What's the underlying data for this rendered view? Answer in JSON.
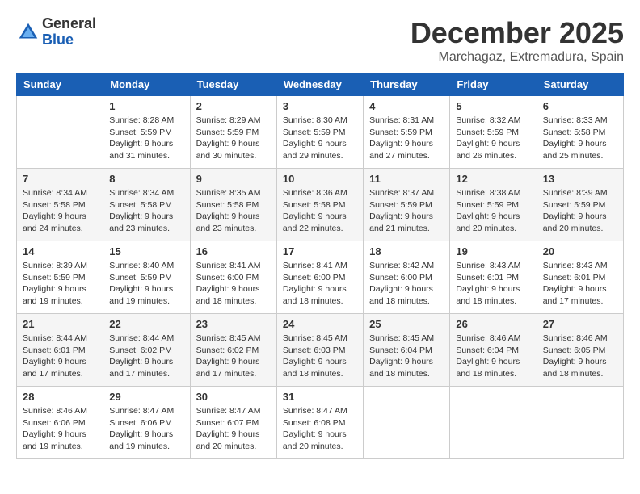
{
  "logo": {
    "general": "General",
    "blue": "Blue"
  },
  "title": "December 2025",
  "location": "Marchagaz, Extremadura, Spain",
  "days_of_week": [
    "Sunday",
    "Monday",
    "Tuesday",
    "Wednesday",
    "Thursday",
    "Friday",
    "Saturday"
  ],
  "weeks": [
    [
      {
        "day": "",
        "sunrise": "",
        "sunset": "",
        "daylight": ""
      },
      {
        "day": "1",
        "sunrise": "Sunrise: 8:28 AM",
        "sunset": "Sunset: 5:59 PM",
        "daylight": "Daylight: 9 hours and 31 minutes."
      },
      {
        "day": "2",
        "sunrise": "Sunrise: 8:29 AM",
        "sunset": "Sunset: 5:59 PM",
        "daylight": "Daylight: 9 hours and 30 minutes."
      },
      {
        "day": "3",
        "sunrise": "Sunrise: 8:30 AM",
        "sunset": "Sunset: 5:59 PM",
        "daylight": "Daylight: 9 hours and 29 minutes."
      },
      {
        "day": "4",
        "sunrise": "Sunrise: 8:31 AM",
        "sunset": "Sunset: 5:59 PM",
        "daylight": "Daylight: 9 hours and 27 minutes."
      },
      {
        "day": "5",
        "sunrise": "Sunrise: 8:32 AM",
        "sunset": "Sunset: 5:59 PM",
        "daylight": "Daylight: 9 hours and 26 minutes."
      },
      {
        "day": "6",
        "sunrise": "Sunrise: 8:33 AM",
        "sunset": "Sunset: 5:58 PM",
        "daylight": "Daylight: 9 hours and 25 minutes."
      }
    ],
    [
      {
        "day": "7",
        "sunrise": "Sunrise: 8:34 AM",
        "sunset": "Sunset: 5:58 PM",
        "daylight": "Daylight: 9 hours and 24 minutes."
      },
      {
        "day": "8",
        "sunrise": "Sunrise: 8:34 AM",
        "sunset": "Sunset: 5:58 PM",
        "daylight": "Daylight: 9 hours and 23 minutes."
      },
      {
        "day": "9",
        "sunrise": "Sunrise: 8:35 AM",
        "sunset": "Sunset: 5:58 PM",
        "daylight": "Daylight: 9 hours and 23 minutes."
      },
      {
        "day": "10",
        "sunrise": "Sunrise: 8:36 AM",
        "sunset": "Sunset: 5:58 PM",
        "daylight": "Daylight: 9 hours and 22 minutes."
      },
      {
        "day": "11",
        "sunrise": "Sunrise: 8:37 AM",
        "sunset": "Sunset: 5:59 PM",
        "daylight": "Daylight: 9 hours and 21 minutes."
      },
      {
        "day": "12",
        "sunrise": "Sunrise: 8:38 AM",
        "sunset": "Sunset: 5:59 PM",
        "daylight": "Daylight: 9 hours and 20 minutes."
      },
      {
        "day": "13",
        "sunrise": "Sunrise: 8:39 AM",
        "sunset": "Sunset: 5:59 PM",
        "daylight": "Daylight: 9 hours and 20 minutes."
      }
    ],
    [
      {
        "day": "14",
        "sunrise": "Sunrise: 8:39 AM",
        "sunset": "Sunset: 5:59 PM",
        "daylight": "Daylight: 9 hours and 19 minutes."
      },
      {
        "day": "15",
        "sunrise": "Sunrise: 8:40 AM",
        "sunset": "Sunset: 5:59 PM",
        "daylight": "Daylight: 9 hours and 19 minutes."
      },
      {
        "day": "16",
        "sunrise": "Sunrise: 8:41 AM",
        "sunset": "Sunset: 6:00 PM",
        "daylight": "Daylight: 9 hours and 18 minutes."
      },
      {
        "day": "17",
        "sunrise": "Sunrise: 8:41 AM",
        "sunset": "Sunset: 6:00 PM",
        "daylight": "Daylight: 9 hours and 18 minutes."
      },
      {
        "day": "18",
        "sunrise": "Sunrise: 8:42 AM",
        "sunset": "Sunset: 6:00 PM",
        "daylight": "Daylight: 9 hours and 18 minutes."
      },
      {
        "day": "19",
        "sunrise": "Sunrise: 8:43 AM",
        "sunset": "Sunset: 6:01 PM",
        "daylight": "Daylight: 9 hours and 18 minutes."
      },
      {
        "day": "20",
        "sunrise": "Sunrise: 8:43 AM",
        "sunset": "Sunset: 6:01 PM",
        "daylight": "Daylight: 9 hours and 17 minutes."
      }
    ],
    [
      {
        "day": "21",
        "sunrise": "Sunrise: 8:44 AM",
        "sunset": "Sunset: 6:01 PM",
        "daylight": "Daylight: 9 hours and 17 minutes."
      },
      {
        "day": "22",
        "sunrise": "Sunrise: 8:44 AM",
        "sunset": "Sunset: 6:02 PM",
        "daylight": "Daylight: 9 hours and 17 minutes."
      },
      {
        "day": "23",
        "sunrise": "Sunrise: 8:45 AM",
        "sunset": "Sunset: 6:02 PM",
        "daylight": "Daylight: 9 hours and 17 minutes."
      },
      {
        "day": "24",
        "sunrise": "Sunrise: 8:45 AM",
        "sunset": "Sunset: 6:03 PM",
        "daylight": "Daylight: 9 hours and 18 minutes."
      },
      {
        "day": "25",
        "sunrise": "Sunrise: 8:45 AM",
        "sunset": "Sunset: 6:04 PM",
        "daylight": "Daylight: 9 hours and 18 minutes."
      },
      {
        "day": "26",
        "sunrise": "Sunrise: 8:46 AM",
        "sunset": "Sunset: 6:04 PM",
        "daylight": "Daylight: 9 hours and 18 minutes."
      },
      {
        "day": "27",
        "sunrise": "Sunrise: 8:46 AM",
        "sunset": "Sunset: 6:05 PM",
        "daylight": "Daylight: 9 hours and 18 minutes."
      }
    ],
    [
      {
        "day": "28",
        "sunrise": "Sunrise: 8:46 AM",
        "sunset": "Sunset: 6:06 PM",
        "daylight": "Daylight: 9 hours and 19 minutes."
      },
      {
        "day": "29",
        "sunrise": "Sunrise: 8:47 AM",
        "sunset": "Sunset: 6:06 PM",
        "daylight": "Daylight: 9 hours and 19 minutes."
      },
      {
        "day": "30",
        "sunrise": "Sunrise: 8:47 AM",
        "sunset": "Sunset: 6:07 PM",
        "daylight": "Daylight: 9 hours and 20 minutes."
      },
      {
        "day": "31",
        "sunrise": "Sunrise: 8:47 AM",
        "sunset": "Sunset: 6:08 PM",
        "daylight": "Daylight: 9 hours and 20 minutes."
      },
      {
        "day": "",
        "sunrise": "",
        "sunset": "",
        "daylight": ""
      },
      {
        "day": "",
        "sunrise": "",
        "sunset": "",
        "daylight": ""
      },
      {
        "day": "",
        "sunrise": "",
        "sunset": "",
        "daylight": ""
      }
    ]
  ]
}
